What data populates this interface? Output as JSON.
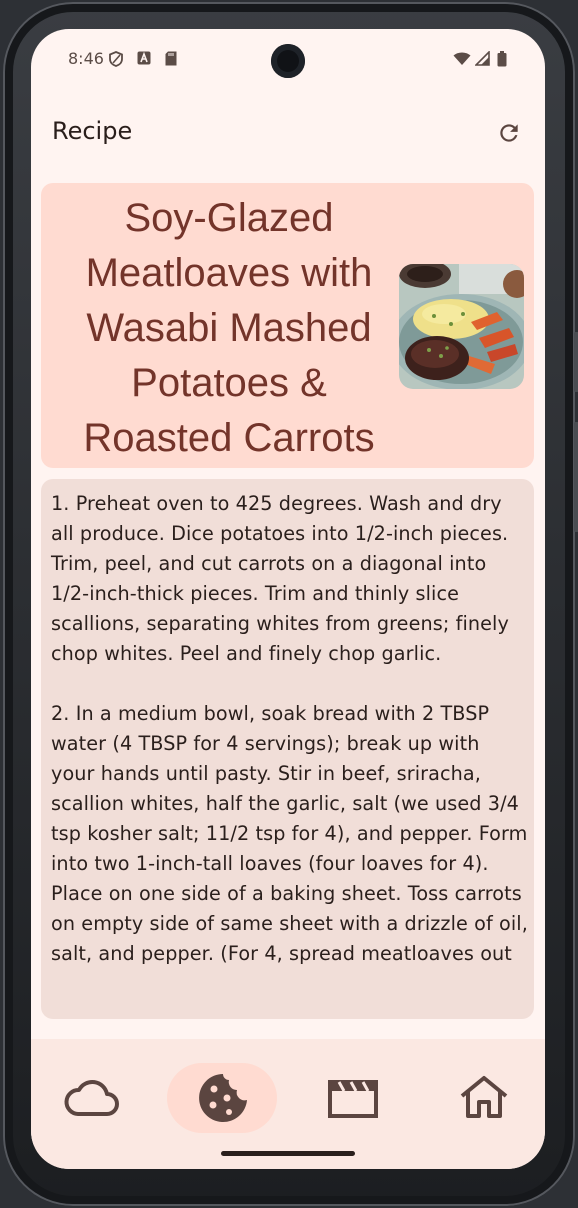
{
  "status_bar": {
    "time": "8:46",
    "icons": [
      "shield-icon",
      "a-icon",
      "sd-card-icon",
      "wifi-icon",
      "signal-icon",
      "battery-icon"
    ]
  },
  "top_bar": {
    "title": "Recipe",
    "action_icon": "refresh-icon"
  },
  "recipe": {
    "title": "Soy-Glazed\nMeatloaves with\nWasabi Mashed\nPotatoes &\nRoasted Carrots",
    "image_alt": "meatloaf-plate-photo",
    "instructions": "1. Preheat oven to 425 degrees. Wash and dry all produce. Dice potatoes into 1/2-inch pieces. Trim, peel, and cut carrots on a diagonal into 1/2-inch-thick pieces. Trim and thinly slice scallions, separating whites from greens; finely chop whites. Peel and finely chop garlic.\n\n2. In a medium bowl, soak bread with 2 TBSP water (4 TBSP for 4 servings); break up with your hands until pasty. Stir in beef, sriracha, scallion whites, half the garlic, salt (we used 3/4 tsp kosher salt; 11/2 tsp for 4), and pepper. Form into two 1-inch-tall loaves (four loaves for 4). Place on one side of a baking sheet. Toss carrots on empty side of same sheet with a drizzle of oil, salt, and pepper. (For 4, spread meatloaves out"
  },
  "nav": {
    "items": [
      {
        "icon": "cloud-icon",
        "active": false
      },
      {
        "icon": "cookie-icon",
        "active": true
      },
      {
        "icon": "movie-icon",
        "active": false
      },
      {
        "icon": "home-icon",
        "active": false
      }
    ]
  },
  "colors": {
    "background": "#fff4f1",
    "header_card": "#ffdbd1",
    "header_text": "#73342a",
    "body_card": "#f1ded8",
    "nav_bg": "#fbe8e2",
    "icon": "#5b4540"
  }
}
